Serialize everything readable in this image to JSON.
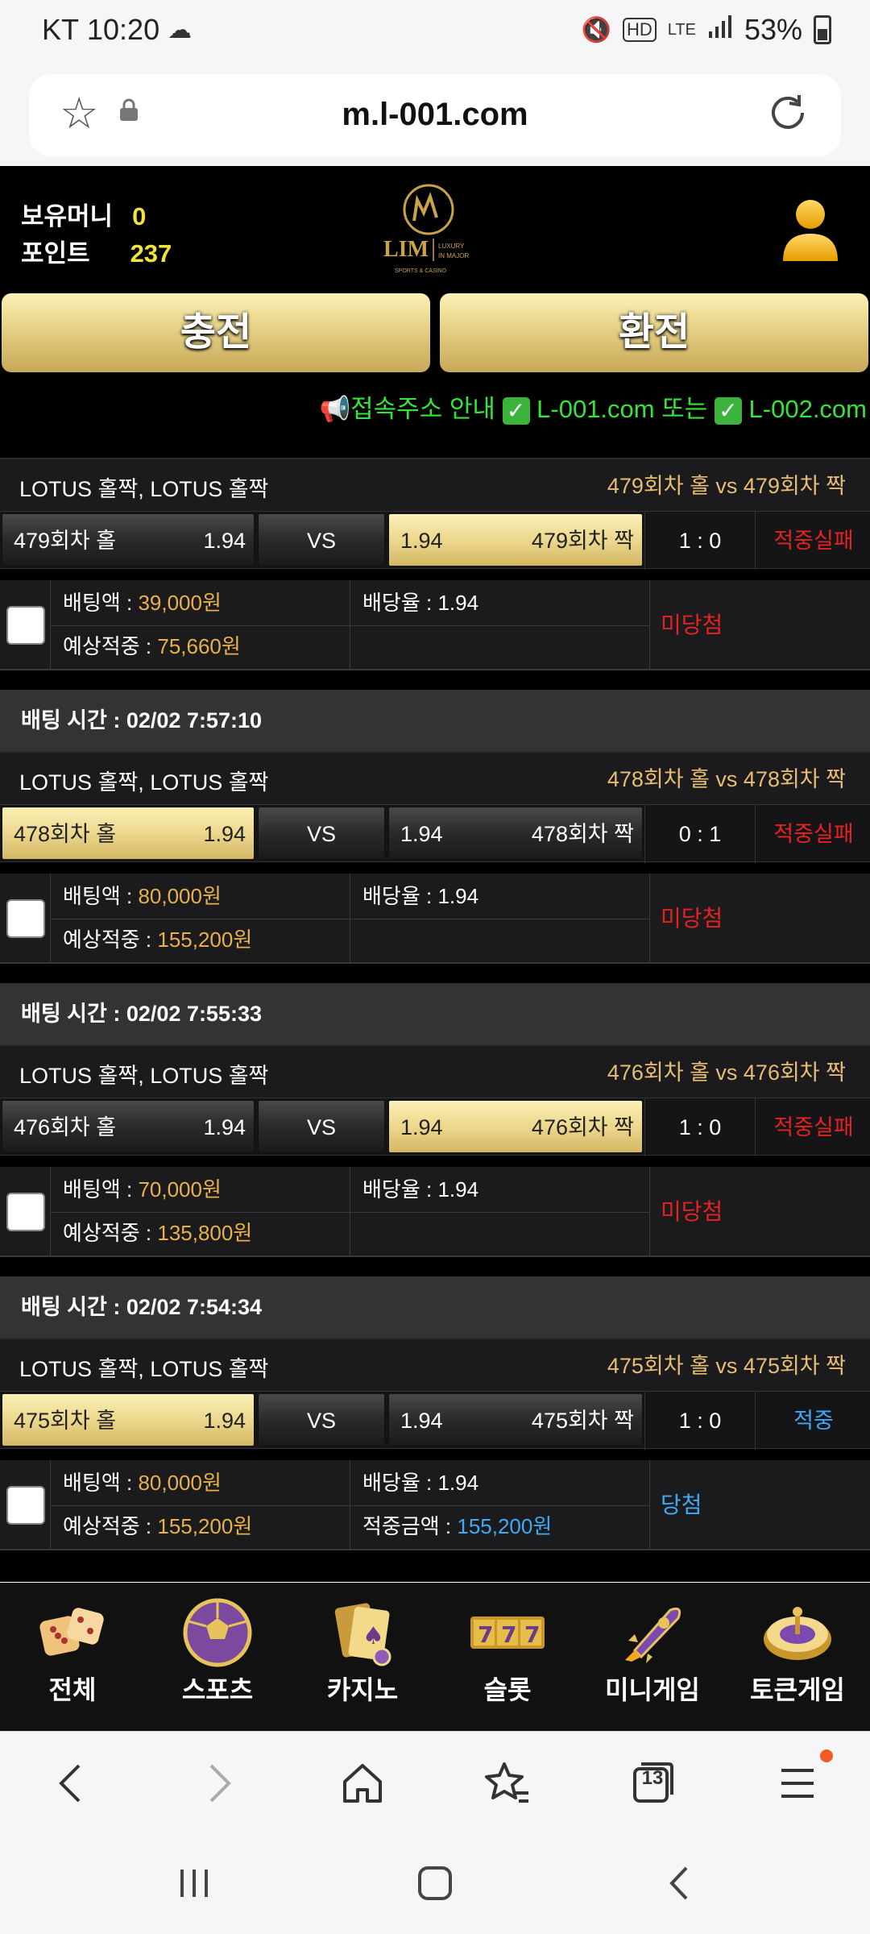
{
  "status": {
    "carrier": "KT",
    "time": "10:20",
    "network": "LTE",
    "battery": "53%"
  },
  "browser": {
    "url": "m.l-001.com",
    "tab_count": "13"
  },
  "header": {
    "money_label": "보유머니",
    "money_value": "0",
    "points_label": "포인트",
    "points_value": "237",
    "logo_text": "LIM",
    "logo_sub": "LUXURY IN MAJOR",
    "logo_sub2": "SPORTS & CASINO",
    "charge_label": "충전",
    "exchange_label": "환전",
    "notice_prefix": "📢접속주소 안내",
    "notice_url1": "L-001.com",
    "notice_mid": "또는",
    "notice_url2": "L-002.com"
  },
  "bets": [
    {
      "time": "",
      "game": "LOTUS 홀짝, LOTUS 홀짝",
      "matchup": "479회차 홀  vs  479회차 짝",
      "home": "479회차 홀",
      "home_odds": "1.94",
      "vs": "VS",
      "away_odds": "1.94",
      "away": "479회차 짝",
      "selected": "away",
      "score": "1 : 0",
      "result": "적중실패",
      "bet_label": "배팅액 : ",
      "bet_amount": "39,000원",
      "expected_label": "예상적중 : ",
      "expected": "75,660원",
      "odds_label": "배당율 : ",
      "odds": "1.94",
      "win_label": "",
      "win_amount": "",
      "status": "미당첨"
    },
    {
      "time": "배팅 시간 : 02/02 7:57:10",
      "game": "LOTUS 홀짝, LOTUS 홀짝",
      "matchup": "478회차 홀  vs  478회차 짝",
      "home": "478회차 홀",
      "home_odds": "1.94",
      "vs": "VS",
      "away_odds": "1.94",
      "away": "478회차 짝",
      "selected": "home",
      "score": "0 : 1",
      "result": "적중실패",
      "bet_label": "배팅액 : ",
      "bet_amount": "80,000원",
      "expected_label": "예상적중 : ",
      "expected": "155,200원",
      "odds_label": "배당율 : ",
      "odds": "1.94",
      "win_label": "",
      "win_amount": "",
      "status": "미당첨"
    },
    {
      "time": "배팅 시간 : 02/02 7:55:33",
      "game": "LOTUS 홀짝, LOTUS 홀짝",
      "matchup": "476회차 홀  vs  476회차 짝",
      "home": "476회차 홀",
      "home_odds": "1.94",
      "vs": "VS",
      "away_odds": "1.94",
      "away": "476회차 짝",
      "selected": "away",
      "score": "1 : 0",
      "result": "적중실패",
      "bet_label": "배팅액 : ",
      "bet_amount": "70,000원",
      "expected_label": "예상적중 : ",
      "expected": "135,800원",
      "odds_label": "배당율 : ",
      "odds": "1.94",
      "win_label": "",
      "win_amount": "",
      "status": "미당첨"
    },
    {
      "time": "배팅 시간 : 02/02 7:54:34",
      "game": "LOTUS 홀짝, LOTUS 홀짝",
      "matchup": "475회차 홀  vs  475회차 짝",
      "home": "475회차 홀",
      "home_odds": "1.94",
      "vs": "VS",
      "away_odds": "1.94",
      "away": "475회차 짝",
      "selected": "home",
      "score": "1 : 0",
      "result": "적중",
      "bet_label": "배팅액 : ",
      "bet_amount": "80,000원",
      "expected_label": "예상적중 : ",
      "expected": "155,200원",
      "odds_label": "배당율 : ",
      "odds": "1.94",
      "win_label": "적중금액 : ",
      "win_amount": "155,200원",
      "status": "당첨"
    }
  ],
  "game_nav": [
    {
      "label": "전체",
      "icon": "dice-icon"
    },
    {
      "label": "스포츠",
      "icon": "soccer-ball-icon"
    },
    {
      "label": "카지노",
      "icon": "cards-icon"
    },
    {
      "label": "슬롯",
      "icon": "slot-777-icon"
    },
    {
      "label": "미니게임",
      "icon": "rocket-icon"
    },
    {
      "label": "토큰게임",
      "icon": "roulette-icon"
    }
  ],
  "colors": {
    "gold": "#e8d48a",
    "fail_red": "#e52222",
    "win_blue": "#3fa9f5",
    "notice_green": "#35e33a"
  }
}
